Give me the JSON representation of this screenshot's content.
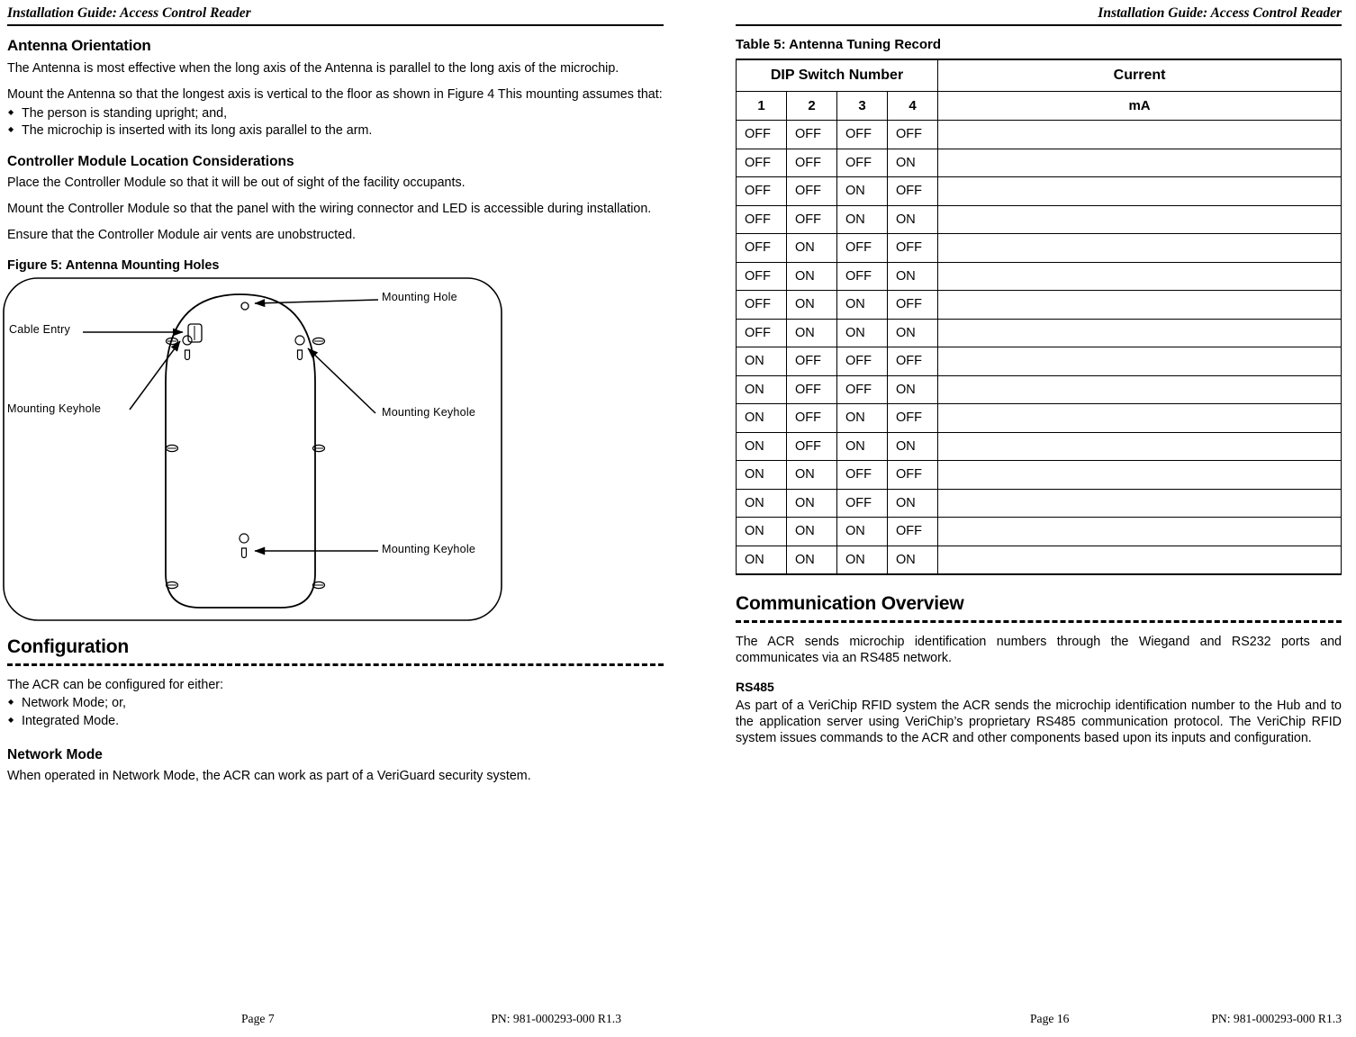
{
  "left_page": {
    "running_head": "Installation Guide: Access Control Reader",
    "section1": {
      "heading": "Antenna Orientation",
      "para1": "The Antenna is most effective when the long axis of the Antenna is parallel to the long axis of the microchip.",
      "para2": "Mount the Antenna so that the longest axis is vertical to the floor as shown in Figure 4 This mounting assumes that:",
      "bullets": [
        "The person is standing upright; and,",
        "The microchip is inserted with its long axis parallel to the arm."
      ]
    },
    "section2": {
      "heading": "Controller Module Location Considerations",
      "para1": "Place the Controller Module so that it will be out of sight of the facility occupants.",
      "para2": "Mount the Controller Module so that the panel with the wiring connector and LED is accessible during installation.",
      "para3": "Ensure that the Controller Module air vents are unobstructed."
    },
    "figure": {
      "caption": "Figure 5: Antenna Mounting Holes",
      "labels": {
        "mounting_hole": "Mounting Hole",
        "cable_entry": "Cable Entry",
        "keyhole_left": "Mounting Keyhole",
        "keyhole_right": "Mounting Keyhole",
        "keyhole_bottom": "Mounting Keyhole"
      }
    },
    "configuration": {
      "heading": "Configuration",
      "para1": "The ACR can be configured for either:",
      "bullets": [
        "Network Mode; or,",
        "Integrated Mode."
      ]
    },
    "network_mode": {
      "heading": "Network Mode",
      "para1": "When operated in Network Mode, the ACR can work as part of a VeriGuard security system."
    },
    "footer": {
      "page": "Page 7",
      "pn": "PN: 981-000293-000 R1.3"
    }
  },
  "right_page": {
    "running_head": "Installation Guide: Access Control Reader",
    "table": {
      "caption": "Table 5:  Antenna Tuning Record",
      "group_headers": [
        "DIP Switch Number",
        "Current"
      ],
      "sub_headers": [
        "1",
        "2",
        "3",
        "4",
        "mA"
      ],
      "rows": [
        [
          "OFF",
          "OFF",
          "OFF",
          "OFF",
          ""
        ],
        [
          "OFF",
          "OFF",
          "OFF",
          "ON",
          ""
        ],
        [
          "OFF",
          "OFF",
          "ON",
          "OFF",
          ""
        ],
        [
          "OFF",
          "OFF",
          "ON",
          "ON",
          ""
        ],
        [
          "OFF",
          "ON",
          "OFF",
          "OFF",
          ""
        ],
        [
          "OFF",
          "ON",
          "OFF",
          "ON",
          ""
        ],
        [
          "OFF",
          "ON",
          "ON",
          "OFF",
          ""
        ],
        [
          "OFF",
          "ON",
          "ON",
          "ON",
          ""
        ],
        [
          "ON",
          "OFF",
          "OFF",
          "OFF",
          ""
        ],
        [
          "ON",
          "OFF",
          "OFF",
          "ON",
          ""
        ],
        [
          "ON",
          "OFF",
          "ON",
          "OFF",
          ""
        ],
        [
          "ON",
          "OFF",
          "ON",
          "ON",
          ""
        ],
        [
          "ON",
          "ON",
          "OFF",
          "OFF",
          ""
        ],
        [
          "ON",
          "ON",
          "OFF",
          "ON",
          ""
        ],
        [
          "ON",
          "ON",
          "ON",
          "OFF",
          ""
        ],
        [
          "ON",
          "ON",
          "ON",
          "ON",
          ""
        ]
      ]
    },
    "communication": {
      "heading": "Communication Overview",
      "para1": "The ACR sends microchip identification numbers through the Wiegand and RS232 ports and communicates via an RS485 network."
    },
    "rs485": {
      "heading": "RS485",
      "para1": "As part of a VeriChip RFID system the ACR sends the microchip identification number to the Hub and to the application server using VeriChip’s proprietary RS485 communication protocol. The VeriChip RFID system issues commands to the ACR and other components based upon its inputs and configuration."
    },
    "footer": {
      "page": "Page 16",
      "pn": "PN: 981-000293-000 R1.3"
    }
  }
}
